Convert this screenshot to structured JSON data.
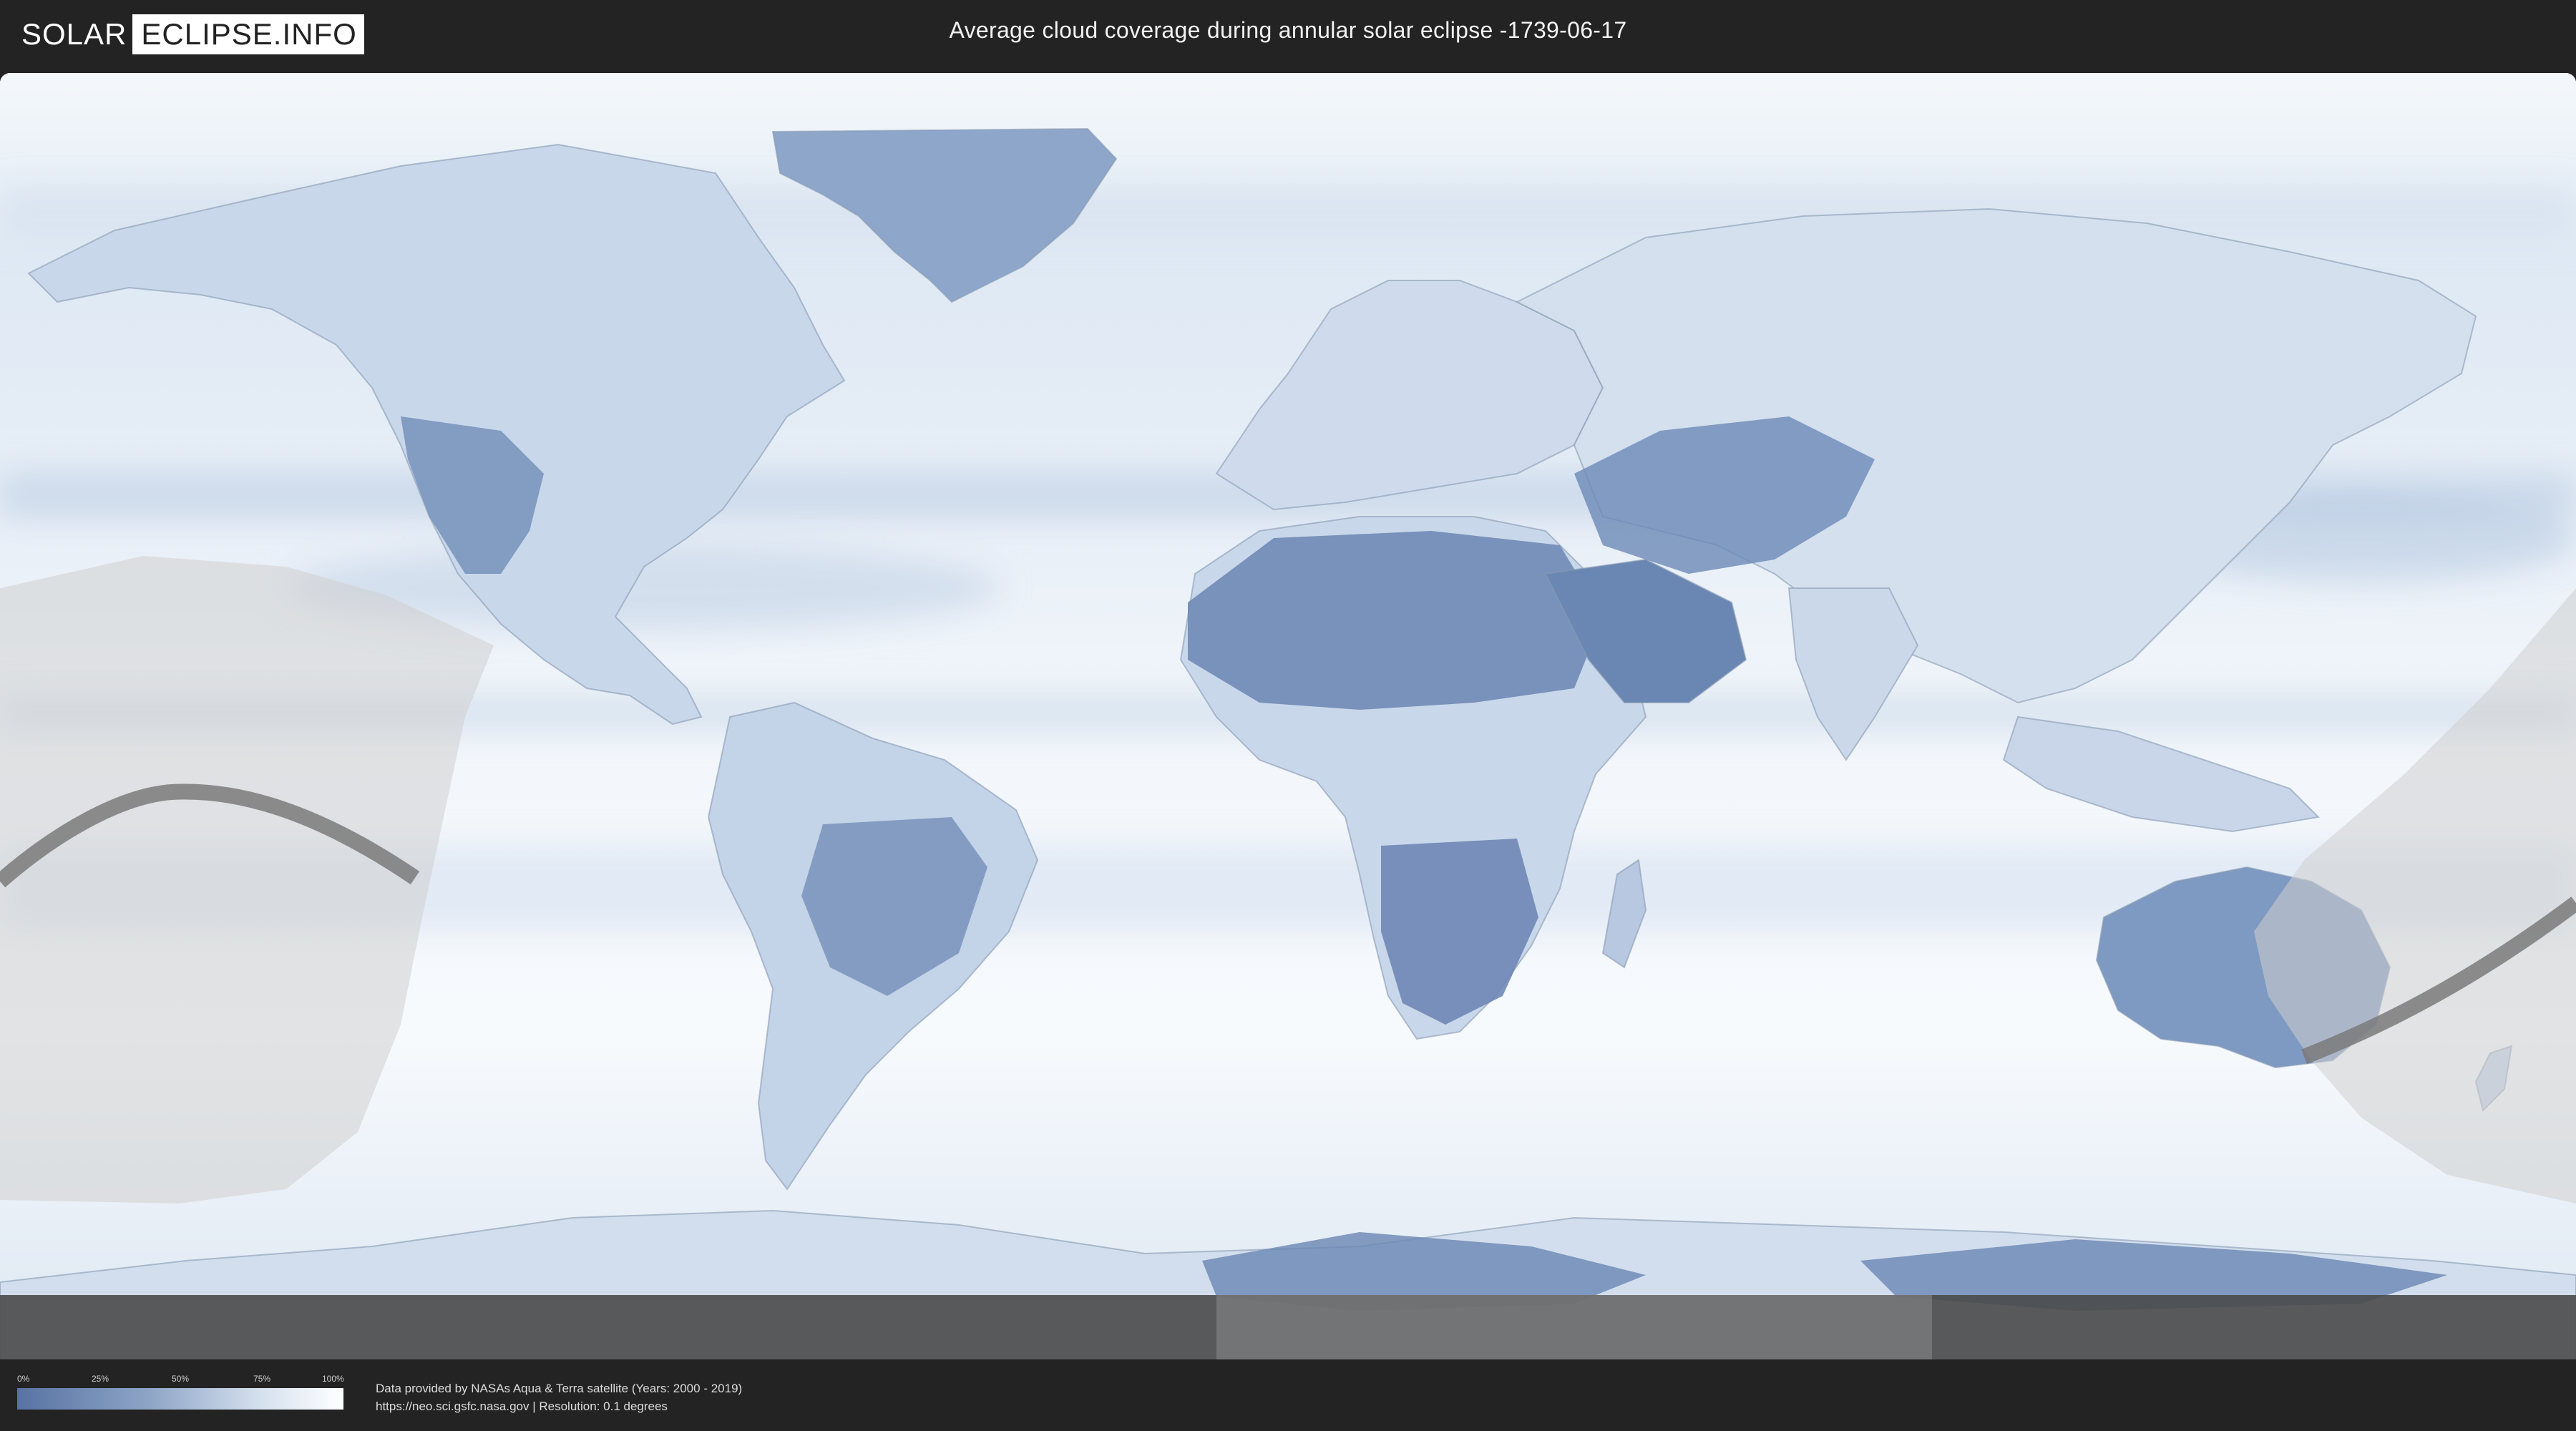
{
  "header": {
    "logo_left": "SOLAR",
    "logo_right": "ECLIPSE.INFO",
    "title": "Average cloud coverage during annular solar eclipse -1739-06-17"
  },
  "legend": {
    "ticks": [
      "0%",
      "25%",
      "50%",
      "75%",
      "100%"
    ],
    "gradient_colors": [
      "#5873a3",
      "#ffffff"
    ]
  },
  "credits": {
    "line1": "Data provided by NASAs Aqua & Terra satellite (Years: 2000 - 2019)",
    "line2": "https://neo.sci.gsfc.nasa.gov | Resolution: 0.1 degrees"
  },
  "map": {
    "ocean_color": "#e3ecf5",
    "cloudy_color": "#ffffff",
    "clear_color": "#5a77a7",
    "eclipse_zone_color": "#c8c8c8"
  }
}
